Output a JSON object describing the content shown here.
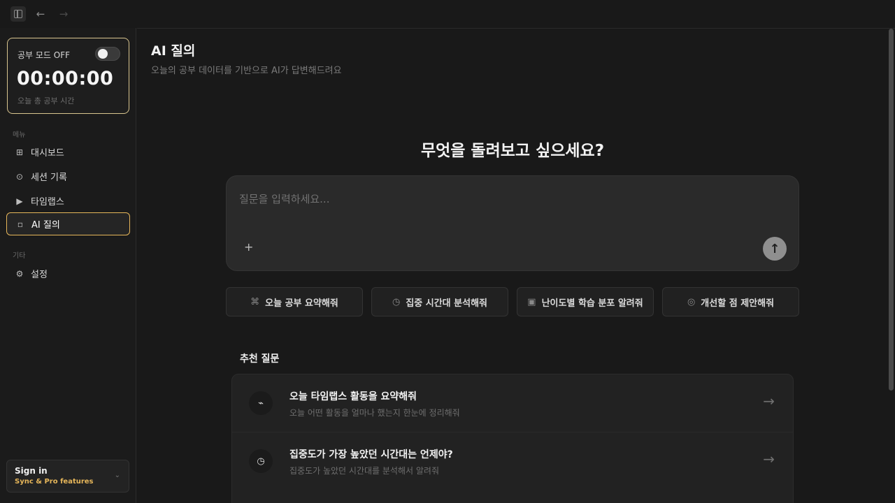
{
  "topbar": {
    "sidebar_icon": "sidebar-toggle-icon",
    "back_glyph": "←",
    "forward_glyph": "→"
  },
  "sidebar": {
    "study_mode_label": "공부 모드 OFF",
    "timer": "00:00:00",
    "timer_caption": "오늘 총 공부 시간",
    "menu_label": "메뉴",
    "items": [
      {
        "label": "대시보드",
        "icon": "⊞"
      },
      {
        "label": "세션 기록",
        "icon": "⊙"
      },
      {
        "label": "타임랩스",
        "icon": "▶"
      },
      {
        "label": "AI 질의",
        "icon": "▫"
      }
    ],
    "other_label": "기타",
    "settings": {
      "label": "설정",
      "icon": "⚙"
    },
    "signin": {
      "title": "Sign in",
      "subtitle": "Sync & Pro features",
      "chevron": "⌄"
    },
    "accent_color": "#e6b65a"
  },
  "main": {
    "title": "AI 질의",
    "subtitle": "오늘의 공부 데이터를 기반으로 AI가 답변해드려요",
    "hero": "무엇을 돌려보고 싶으세요?",
    "ask": {
      "placeholder": "질문을 입력하세요...",
      "plus": "+",
      "send": "↑"
    },
    "chips": [
      {
        "label": "오늘 공부 요약해줘",
        "icon": "⌘"
      },
      {
        "label": "집중 시간대 분석해줘",
        "icon": "◷"
      },
      {
        "label": "난이도별 학습 분포 알려줘",
        "icon": "▣"
      },
      {
        "label": "개선할 점 제안해줘",
        "icon": "◎"
      }
    ],
    "recommended_title": "추천 질문",
    "recommended": [
      {
        "title": "오늘 타임랩스 활동을 요약해줘",
        "desc": "오늘 어떤 활동을 얼마나 했는지 한눈에 정리해줘",
        "icon": "⌁",
        "arrow": "→"
      },
      {
        "title": "집중도가 가장 높았던 시간대는 언제야?",
        "desc": "집중도가 높았던 시간대를 분석해서 알려줘",
        "icon": "◷",
        "arrow": "→"
      }
    ]
  }
}
